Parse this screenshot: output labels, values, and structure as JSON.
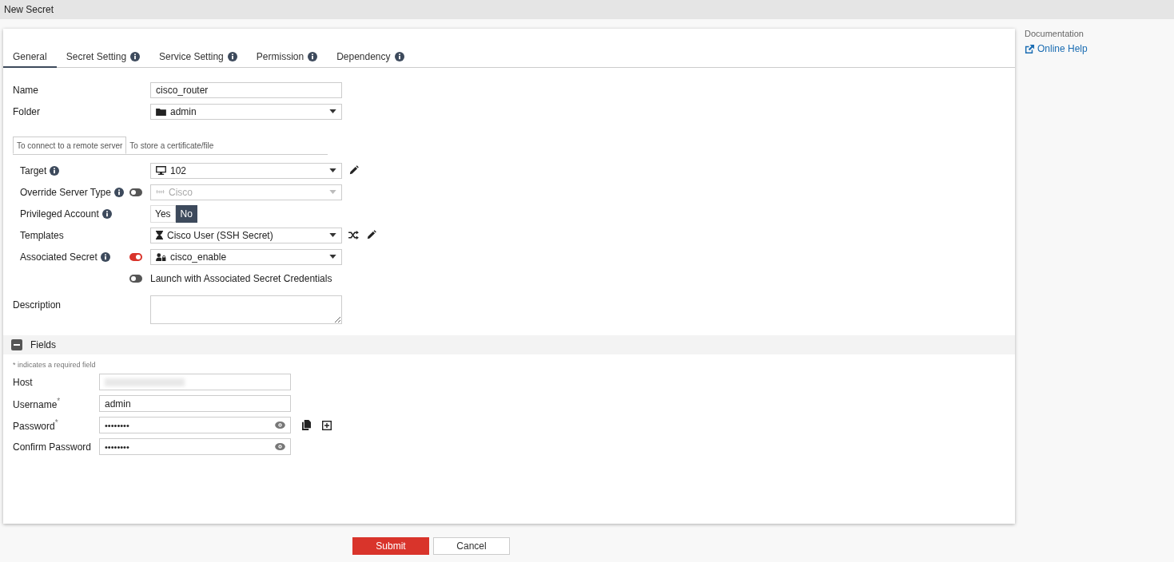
{
  "window": {
    "title": "New Secret"
  },
  "tabs": [
    {
      "label": "General",
      "selected": true,
      "info": false
    },
    {
      "label": "Secret Setting",
      "selected": false,
      "info": true
    },
    {
      "label": "Service Setting",
      "selected": false,
      "info": true
    },
    {
      "label": "Permission",
      "selected": false,
      "info": true
    },
    {
      "label": "Dependency",
      "selected": false,
      "info": true
    }
  ],
  "name_field": {
    "label": "Name",
    "value": "cisco_router"
  },
  "folder_field": {
    "label": "Folder",
    "value": "admin"
  },
  "mode_tabs": [
    {
      "label": "To connect to a remote server",
      "selected": true
    },
    {
      "label": "To store a certificate/file",
      "selected": false
    }
  ],
  "target": {
    "label": "Target",
    "value": "102"
  },
  "override_server_type": {
    "label": "Override Server Type",
    "on": false,
    "value": "Cisco",
    "disabled": true
  },
  "privileged_account": {
    "label": "Privileged Account",
    "options": [
      {
        "label": "Yes",
        "selected": false
      },
      {
        "label": "No",
        "selected": true
      }
    ]
  },
  "templates": {
    "label": "Templates",
    "value": "Cisco User (SSH Secret)"
  },
  "associated_secret": {
    "label": "Associated Secret",
    "on": true,
    "value": "cisco_enable"
  },
  "launch_with_credentials": {
    "label": "Launch with Associated Secret Credentials",
    "on": false
  },
  "description": {
    "label": "Description"
  },
  "fields_section": {
    "title": "Fields",
    "expanded": true,
    "note": "* indicates a required field",
    "fields": [
      {
        "label": "Host",
        "kind": "text",
        "blurred": true
      },
      {
        "label": "Username$^{*}$",
        "kind": "text",
        "value": "admin"
      },
      {
        "label": "Password$^{*}$",
        "kind": "password",
        "value": "••••••••"
      },
      {
        "label": "Confirm Password",
        "kind": "confirm",
        "value": "••••••••"
      }
    ]
  },
  "sidebar": {
    "heading": "Documentation",
    "link": "Online Help"
  },
  "buttons": [
    {
      "label": "Submit",
      "kind": "primary"
    },
    {
      "label": "Cancel",
      "kind": "secondary"
    }
  ]
}
